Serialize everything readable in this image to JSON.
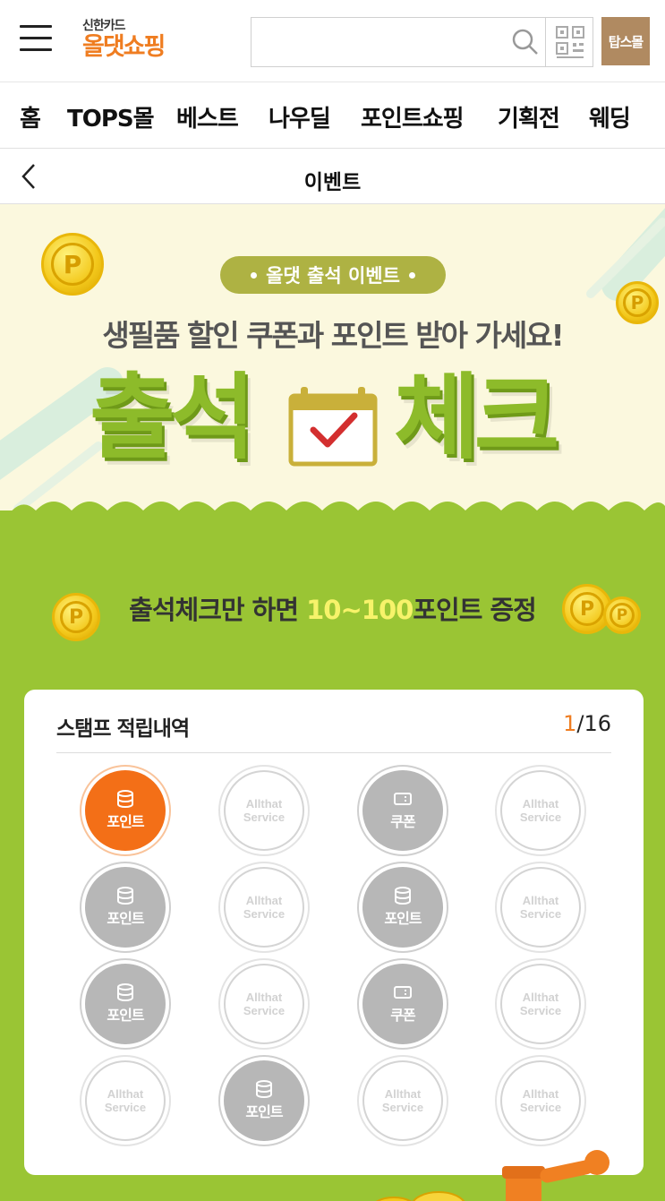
{
  "header": {
    "logo_sub": "신한카드",
    "logo_main": "올댓쇼핑",
    "search_placeholder": "",
    "tops_label": "탑스몰",
    "icons": [
      "menu-icon",
      "search-icon",
      "qr-code-icon"
    ]
  },
  "nav": {
    "items": [
      "홈",
      "TOPS몰",
      "베스트",
      "나우딜",
      "포인트쇼핑",
      "기획전",
      "웨딩"
    ]
  },
  "titlebar": {
    "title": "이벤트"
  },
  "banner": {
    "pill_label": "올댓 출석 이벤트",
    "headline": "생필품 할인 쿠폰과 포인트 받아 가세요!",
    "big_title_left": "출석",
    "big_title_right": "체크",
    "coin_letter": "P"
  },
  "promo": {
    "prefix": "출석체크만 하면 ",
    "highlight": "10~100",
    "suffix": "포인트 증정"
  },
  "stamp_card": {
    "title": "스탬프 적립내역",
    "count_current": "1",
    "count_total": "/16",
    "point_label": "포인트",
    "coupon_label": "쿠폰",
    "service_line1": "Allthat",
    "service_line2": "Service",
    "stamps": [
      {
        "type": "point",
        "active": true
      },
      {
        "type": "service",
        "active": false
      },
      {
        "type": "coupon",
        "active": false
      },
      {
        "type": "service",
        "active": false
      },
      {
        "type": "point",
        "active": false
      },
      {
        "type": "service",
        "active": false
      },
      {
        "type": "point",
        "active": false
      },
      {
        "type": "service",
        "active": false
      },
      {
        "type": "point",
        "active": false
      },
      {
        "type": "service",
        "active": false
      },
      {
        "type": "coupon",
        "active": false
      },
      {
        "type": "service",
        "active": false
      },
      {
        "type": "service",
        "active": false
      },
      {
        "type": "point",
        "active": false
      },
      {
        "type": "service",
        "active": false
      },
      {
        "type": "service",
        "active": false
      }
    ]
  },
  "colors": {
    "brand_orange": "#ef7d21",
    "event_green": "#9ac534",
    "title_green": "#8dbb2a",
    "pill_olive": "#aeb243",
    "banner_bg": "#fbf8de",
    "stamp_active": "#f36f17",
    "stamp_inactive": "#b7b7b7"
  }
}
